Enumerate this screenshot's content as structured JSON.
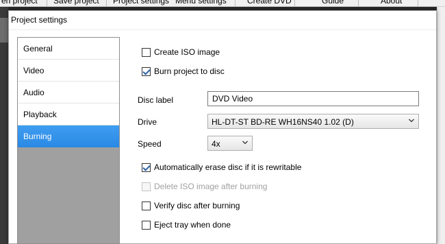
{
  "background_menu": {
    "items": [
      "en project",
      "Save project",
      "Project settings",
      "Menu settings",
      "Create DVD",
      "Guide",
      "About"
    ]
  },
  "dialog": {
    "title": "Project settings"
  },
  "sidebar": {
    "items": [
      {
        "label": "General",
        "active": false
      },
      {
        "label": "Video",
        "active": false
      },
      {
        "label": "Audio",
        "active": false
      },
      {
        "label": "Playback",
        "active": false
      },
      {
        "label": "Burning",
        "active": true
      }
    ]
  },
  "burning": {
    "create_iso": {
      "label": "Create ISO image",
      "checked": false
    },
    "burn_to_disc": {
      "label": "Burn project to disc",
      "checked": true
    },
    "disc_label": {
      "label": "Disc label",
      "value": "DVD Video"
    },
    "drive": {
      "label": "Drive",
      "value": "HL-DT-ST BD-RE  WH16NS40 1.02 (D)"
    },
    "speed": {
      "label": "Speed",
      "value": "4x"
    },
    "auto_erase": {
      "label": "Automatically erase disc if it is rewritable",
      "checked": true
    },
    "delete_iso": {
      "label": "Delete ISO image after burning",
      "checked": false,
      "disabled": true
    },
    "verify_disc": {
      "label": "Verify disc after burning",
      "checked": false
    },
    "eject_tray": {
      "label": "Eject tray when done",
      "checked": false
    }
  },
  "colors": {
    "accent": "#2a89e3",
    "sidebar_background": "#a0a0a0",
    "window_background": "#ffffff"
  }
}
